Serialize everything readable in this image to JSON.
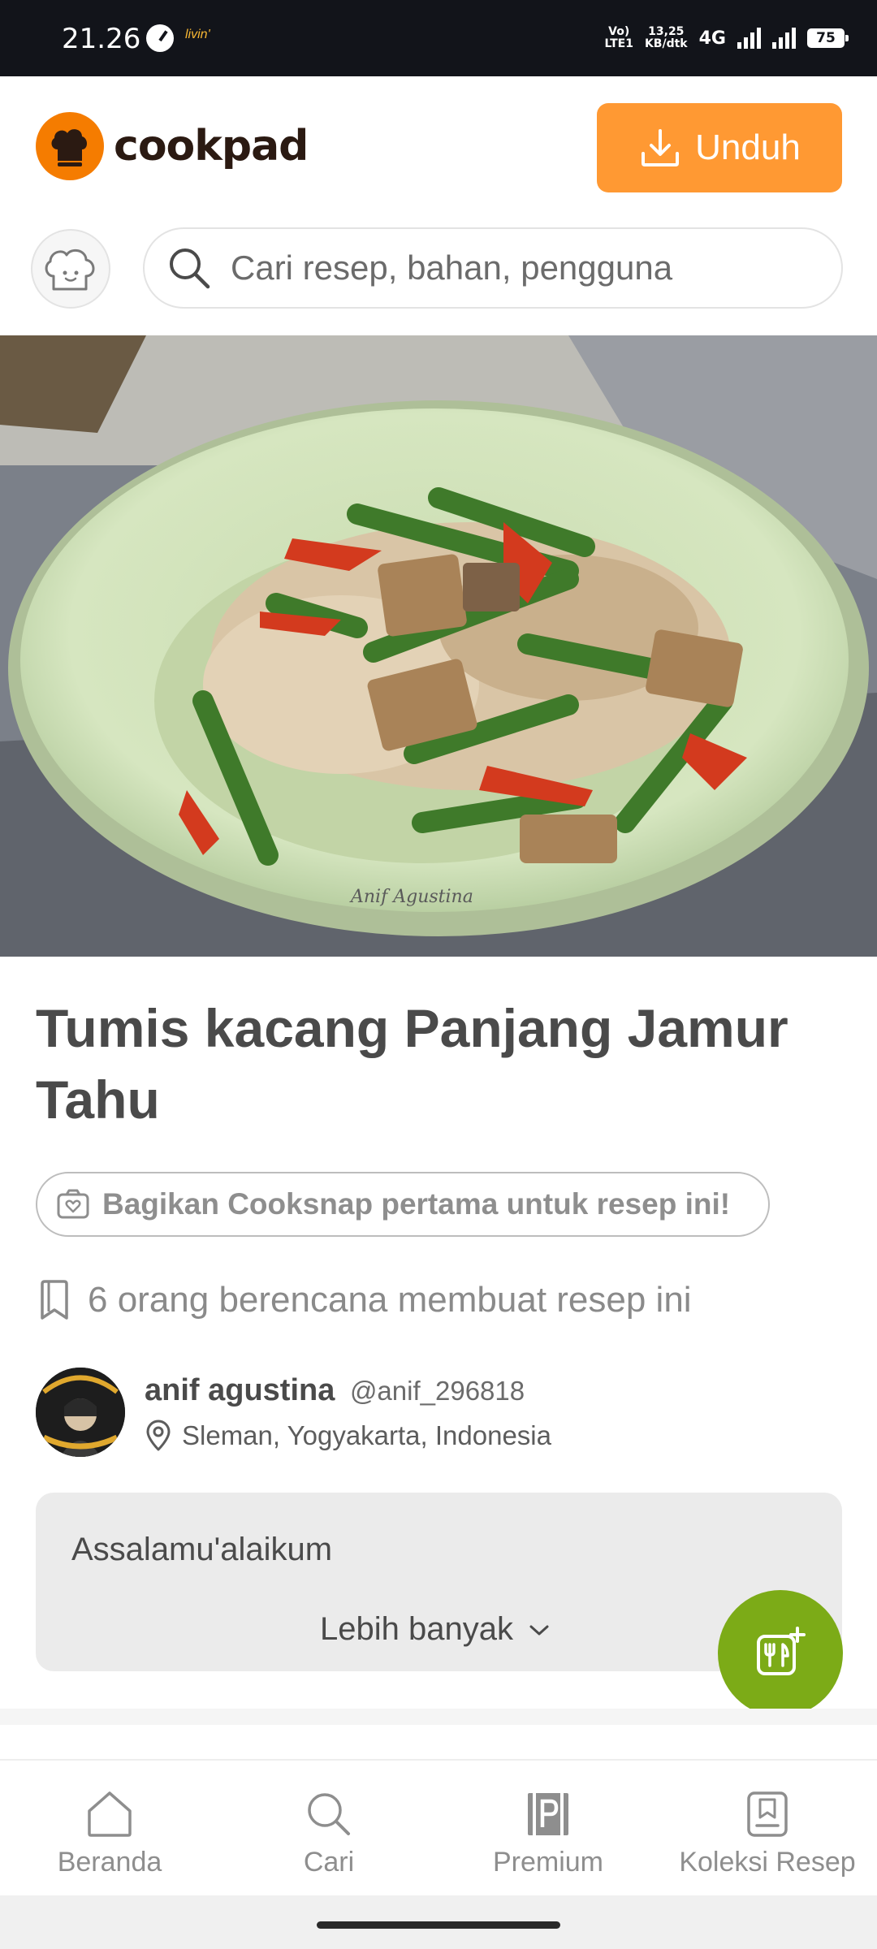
{
  "status_bar": {
    "time": "21.26",
    "app_badge": "livin'",
    "network_top": "Vo)",
    "network_bottom": "LTE1",
    "speed_value": "13,25",
    "speed_unit": "KB/dtk",
    "network_type": "4G",
    "battery": "75"
  },
  "header": {
    "logo_text": "cookpad",
    "download_button": "Unduh",
    "search_placeholder": "Cari resep, bahan, pengguna"
  },
  "recipe": {
    "photo_watermark": "Anif Agustina",
    "title": "Tumis kacang Panjang Jamur Tahu",
    "cooksnap_prompt": "Bagikan Cooksnap pertama untuk resep ini!",
    "planned_text": "6 orang berencana membuat resep ini",
    "author": {
      "name": "anif agustina",
      "handle": "@anif_296818",
      "location": "Sleman, Yogyakarta, Indonesia"
    },
    "description": "Assalamu'alaikum",
    "more_label": "Lebih banyak"
  },
  "bottom_nav": {
    "items": [
      {
        "label": "Beranda",
        "icon": "home-icon"
      },
      {
        "label": "Cari",
        "icon": "search-icon"
      },
      {
        "label": "Premium",
        "icon": "premium-icon"
      },
      {
        "label": "Koleksi Resep",
        "icon": "collection-icon"
      }
    ]
  },
  "colors": {
    "brand_orange": "#f57c00",
    "button_orange": "#ff9933",
    "fab_green": "#7cab17",
    "status_bar": "#12141a"
  }
}
